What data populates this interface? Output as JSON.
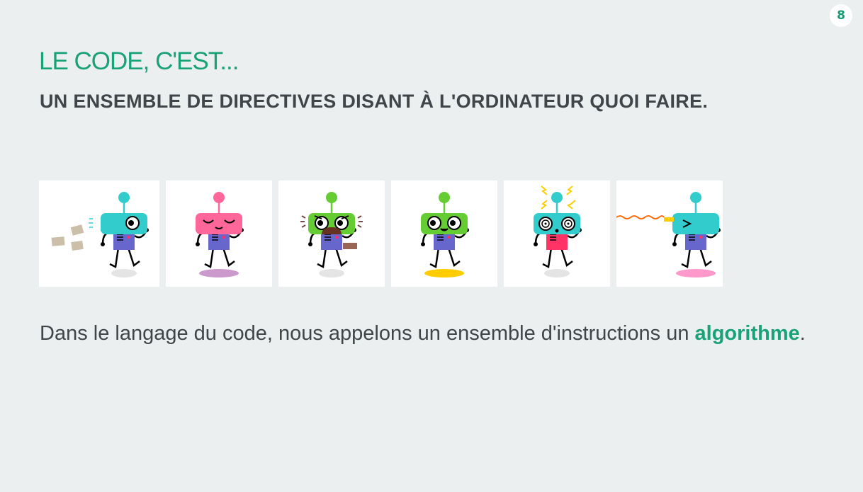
{
  "page_number": "8",
  "title": "LE CODE, C'EST...",
  "subtitle": "UN ENSEMBLE DE DIRECTIVES DISANT À L'ORDINATEUR QUOI FAIRE.",
  "body": {
    "before": "Dans le langage du code, nous appelons un ensemble d'instructions un ",
    "highlight": "algorithme",
    "after": "."
  },
  "colors": {
    "accent": "#19a277",
    "text": "#3f4548",
    "background": "#eceff0"
  },
  "robots": [
    {
      "name": "robot-running-papers",
      "head": "#33cccc",
      "body": "#6666cc",
      "shadow": "#e4e4e4",
      "antenna": "#33cccc",
      "extra": "papers"
    },
    {
      "name": "robot-dancing",
      "head": "#ff6699",
      "body": "#6666cc",
      "shadow": "#cc99cc",
      "antenna": "#ff6699",
      "extra": "none"
    },
    {
      "name": "robot-chocolate",
      "head": "#66cc33",
      "body": "#6666cc",
      "shadow": "#e4e4e4",
      "antenna": "#66cc33",
      "extra": "chocolate"
    },
    {
      "name": "robot-walking-happy",
      "head": "#66cc33",
      "body": "#6666cc",
      "shadow": "#ffcc00",
      "antenna": "#66cc33",
      "extra": "none"
    },
    {
      "name": "robot-dizzy",
      "head": "#33cccc",
      "body": "#ff3366",
      "shadow": "#e4e4e4",
      "antenna": "#33cccc",
      "extra": "sparks"
    },
    {
      "name": "robot-jumping-laser",
      "head": "#33cccc",
      "body": "#6666cc",
      "shadow": "#ff99cc",
      "antenna": "#33cccc",
      "extra": "laser"
    }
  ]
}
